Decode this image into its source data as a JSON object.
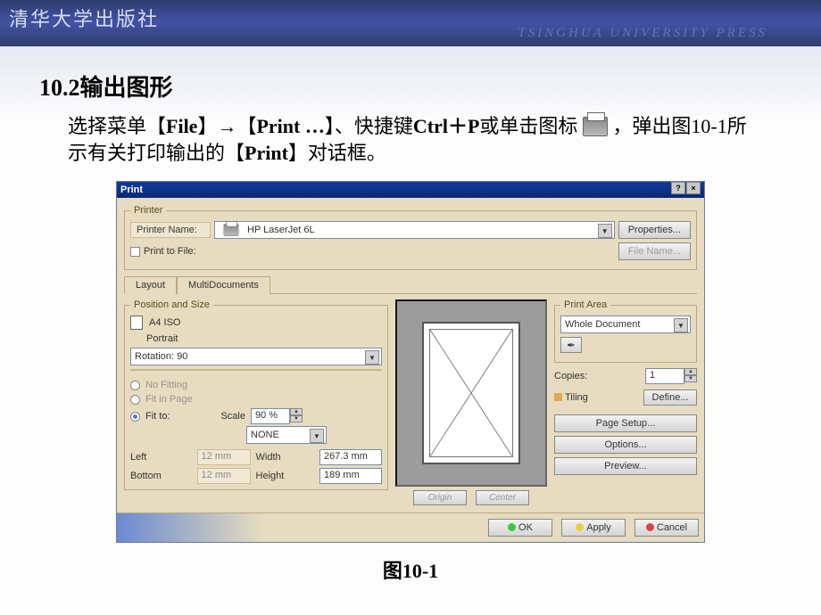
{
  "publisher": {
    "logo": "清华大学出版社",
    "english": "TSINGHUA UNIVERSITY PRESS"
  },
  "heading": "10.2输出图形",
  "body": {
    "part1": "选择菜单【",
    "file": "File",
    "arrow": "】→【",
    "print": "Print …",
    "part2": "】、快捷键",
    "shortcut": "Ctrl＋P",
    "part3": "或单击图标",
    "part4": "，弹出图10-1所示有关打印输出的【",
    "printword": "Print",
    "part5": "】对话框。"
  },
  "dialog": {
    "title": "Print",
    "printer_group": "Printer",
    "printer_name_label": "Printer Name:",
    "printer_name_value": "HP LaserJet 6L",
    "properties_btn": "Properties...",
    "print_to_file": "Print to File:",
    "file_name_btn": "File Name...",
    "tabs": {
      "layout": "Layout",
      "multi": "MultiDocuments"
    },
    "pos_size": "Position and Size",
    "paper": "A4 ISO",
    "orientation": "Portrait",
    "rotation": "Rotation: 90",
    "radio_nofit": "No Fitting",
    "radio_fitpage": "Fit in Page",
    "radio_fitto": "Fit to:",
    "scale_label": "Scale",
    "scale_value": "90 %",
    "scale_mode": "NONE",
    "left_label": "Left",
    "left_value": "12 mm",
    "bottom_label": "Bottom",
    "bottom_value": "12 mm",
    "width_label": "Width",
    "width_value": "267.3 mm",
    "height_label": "Height",
    "height_value": "189 mm",
    "origin_btn": "Origin",
    "center_btn": "Center",
    "print_area_group": "Print Area",
    "print_area_value": "Whole Document",
    "copies_label": "Copies:",
    "copies_value": "1",
    "tiling_label": "Tiling",
    "define_btn": "Define...",
    "page_setup_btn": "Page Setup...",
    "options_btn": "Options...",
    "preview_btn": "Preview...",
    "ok_btn": "OK",
    "apply_btn": "Apply",
    "cancel_btn": "Cancel"
  },
  "caption": "图10-1"
}
